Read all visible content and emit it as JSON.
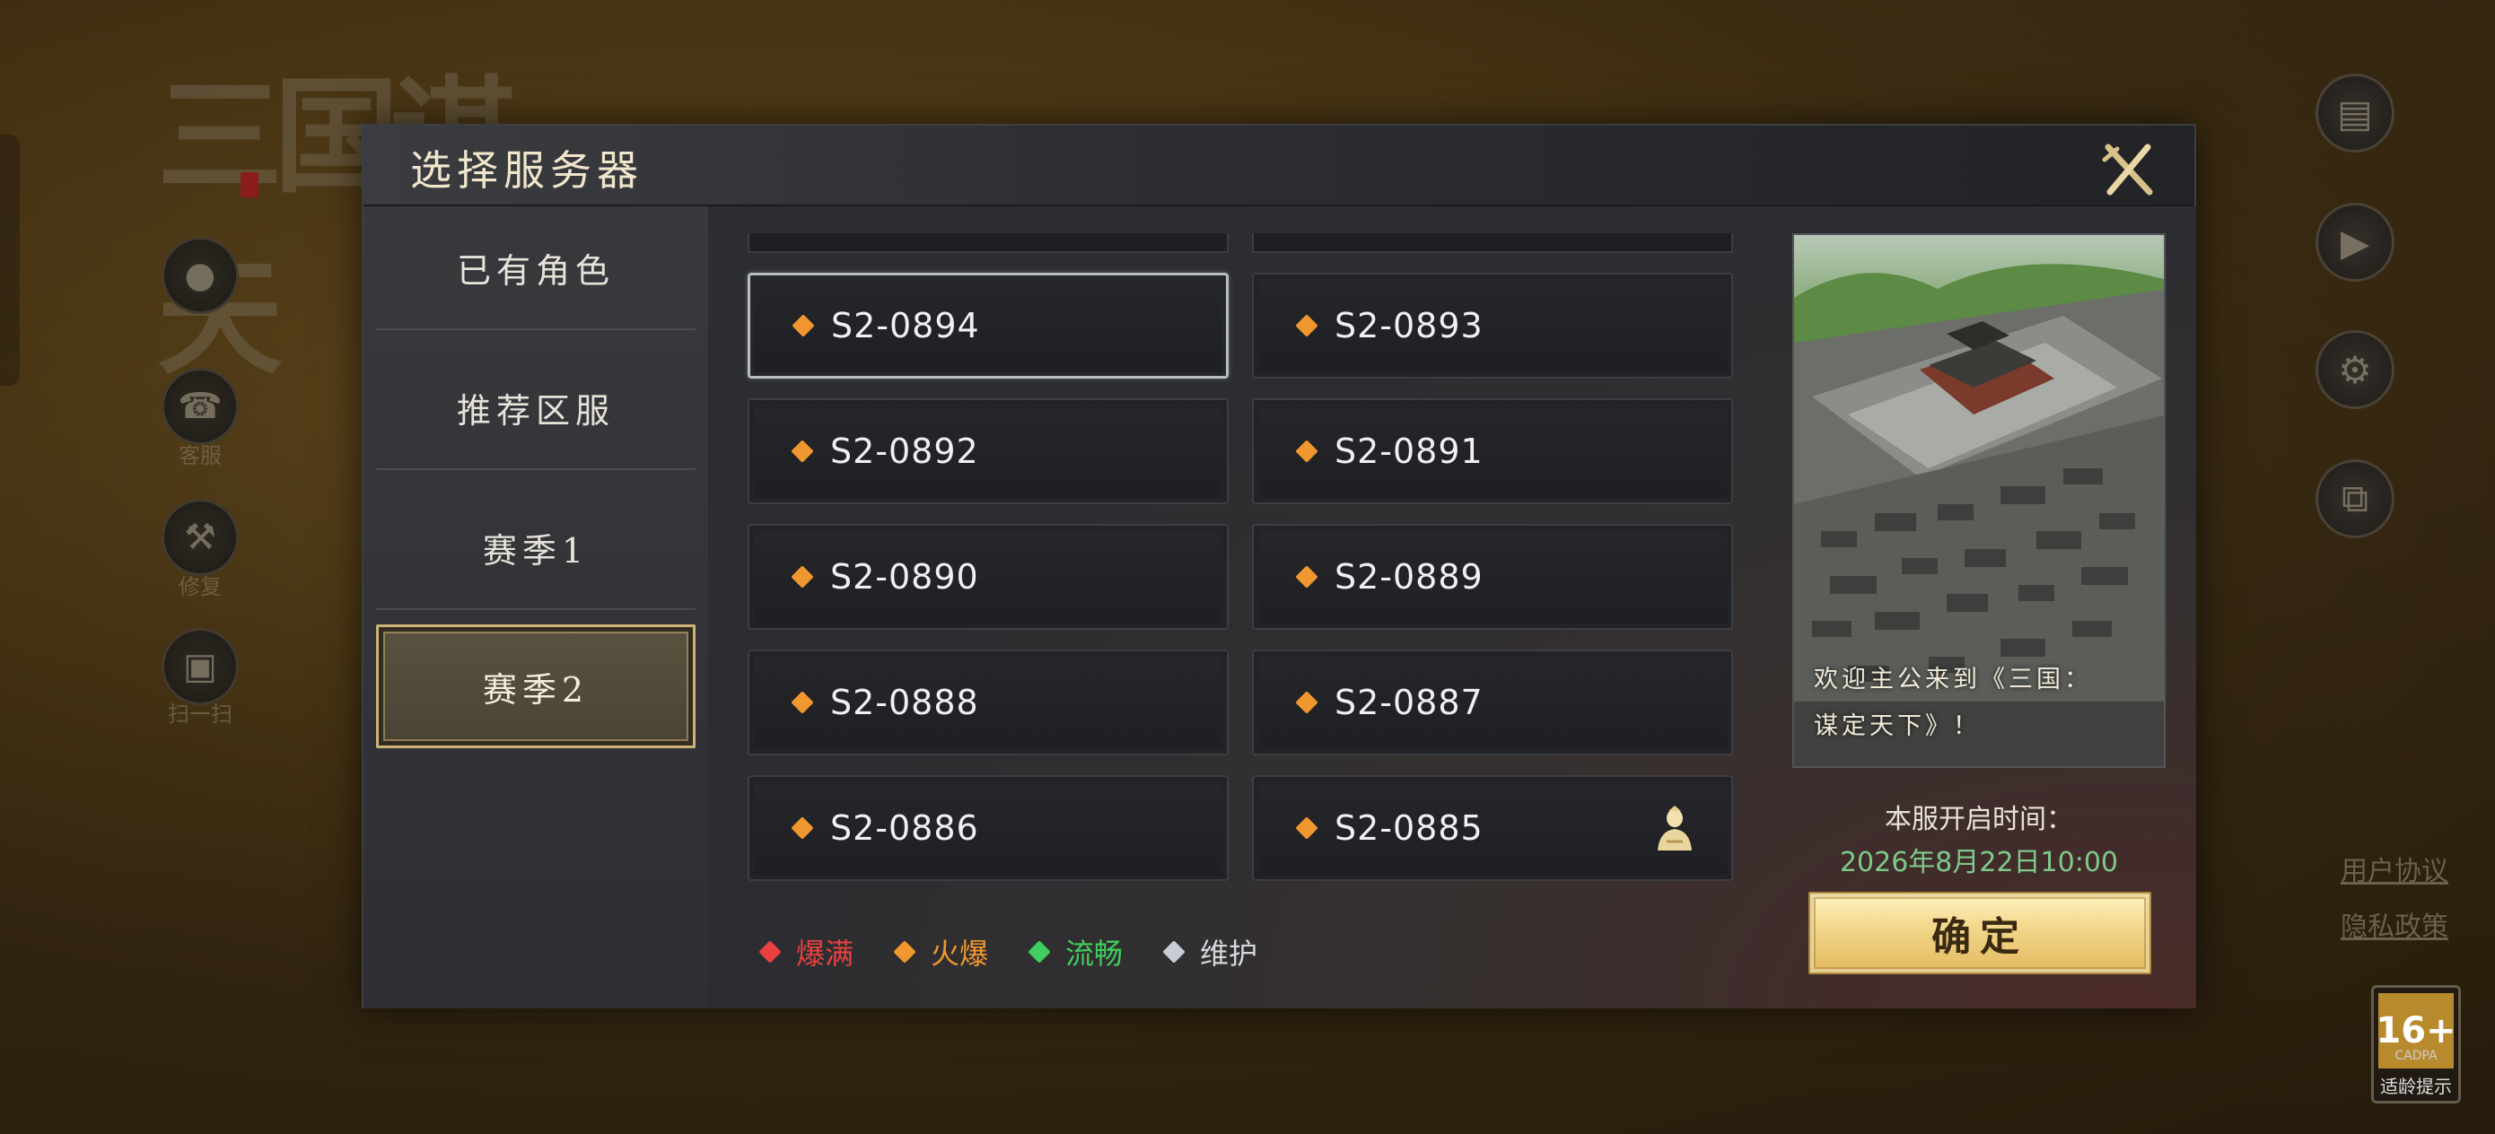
{
  "background": {
    "logo_text": "三国谋天",
    "side_labels": [
      "客服",
      "修复",
      "扫一扫"
    ],
    "right_links": [
      "用户协议",
      "隐私政策"
    ],
    "age_rating": "16+",
    "age_rating_sub": "CADPA",
    "age_rating_label": "适龄提示"
  },
  "dialog": {
    "title": "选择服务器",
    "nav": [
      {
        "label": "已有角色",
        "active": false
      },
      {
        "label": "推荐区服",
        "active": false
      },
      {
        "label": "赛季1",
        "active": false
      },
      {
        "label": "赛季2",
        "active": true
      }
    ],
    "servers": [
      {
        "name": "S2-0894",
        "status": "hot",
        "selected": true,
        "has_character": false
      },
      {
        "name": "S2-0893",
        "status": "hot",
        "selected": false,
        "has_character": false
      },
      {
        "name": "S2-0892",
        "status": "hot",
        "selected": false,
        "has_character": false
      },
      {
        "name": "S2-0891",
        "status": "hot",
        "selected": false,
        "has_character": false
      },
      {
        "name": "S2-0890",
        "status": "hot",
        "selected": false,
        "has_character": false
      },
      {
        "name": "S2-0889",
        "status": "hot",
        "selected": false,
        "has_character": false
      },
      {
        "name": "S2-0888",
        "status": "hot",
        "selected": false,
        "has_character": false
      },
      {
        "name": "S2-0887",
        "status": "hot",
        "selected": false,
        "has_character": false
      },
      {
        "name": "S2-0886",
        "status": "hot",
        "selected": false,
        "has_character": false
      },
      {
        "name": "S2-0885",
        "status": "hot",
        "selected": false,
        "has_character": true
      }
    ],
    "legend": [
      {
        "label": "爆满",
        "color": "#e8413f"
      },
      {
        "label": "火爆",
        "color": "#f0972f"
      },
      {
        "label": "流畅",
        "color": "#3fcf5e"
      },
      {
        "label": "维护",
        "color": "#c9ccd4"
      }
    ],
    "status_colors": {
      "full": "#e8413f",
      "hot": "#f0972f",
      "smooth": "#3fcf5e",
      "maintenance": "#c9ccd4"
    },
    "preview": {
      "caption_line1": "欢迎主公来到《三国：",
      "caption_line2": "谋定天下》！"
    },
    "open_time_label": "本服开启时间：",
    "open_time_value": "2026年8月22日10:00",
    "confirm_label": "确定"
  }
}
